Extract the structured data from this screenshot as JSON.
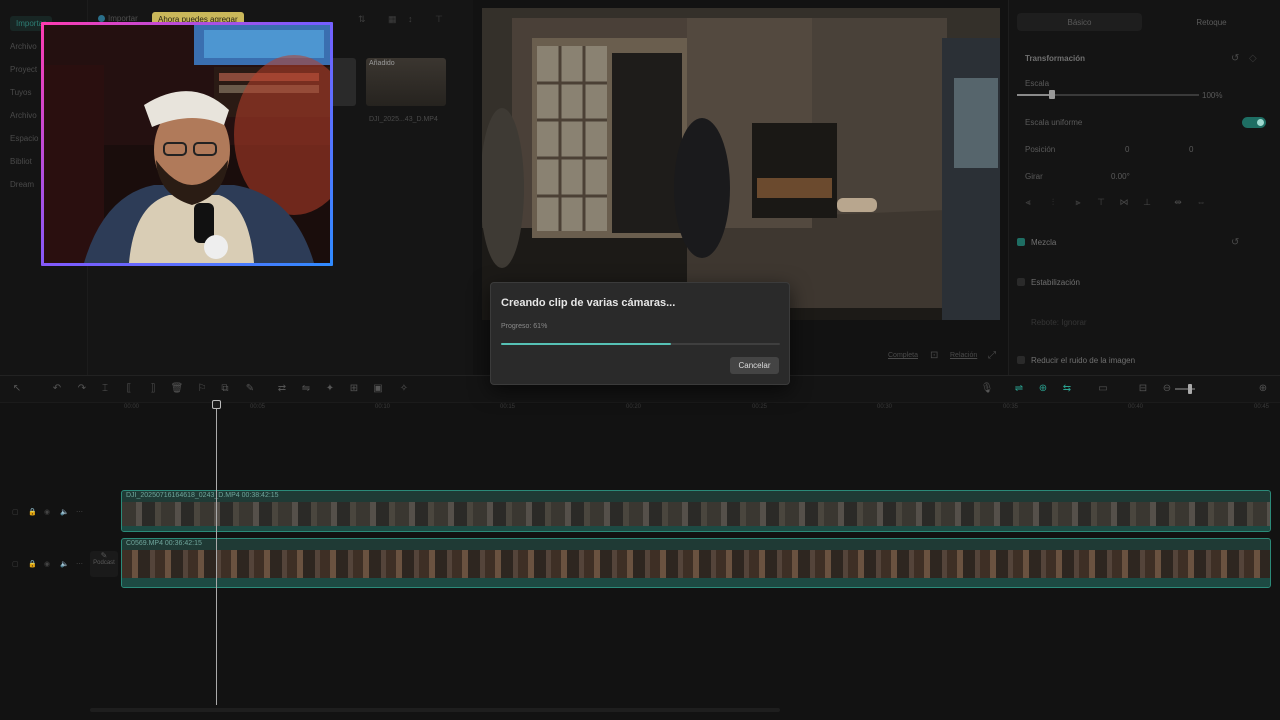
{
  "sidebar": {
    "items": [
      {
        "label": "Importar",
        "active": true
      },
      {
        "label": "Archivo"
      },
      {
        "label": "Proyect"
      },
      {
        "label": "Tuyos"
      },
      {
        "label": "Archivo"
      },
      {
        "label": "Espacio"
      },
      {
        "label": "Bibliot"
      },
      {
        "label": "Dream"
      }
    ]
  },
  "media": {
    "import_label": "Importar",
    "tooltip": "Ahora puedes agregar",
    "added_badge": "Añadido",
    "file_name": "DJI_2025...43_D.MP4"
  },
  "preview": {
    "full_label": "Completa",
    "ratio_label": "Relación"
  },
  "right_panel": {
    "tabs": [
      "Básico",
      "Retoque"
    ],
    "transform_label": "Transformación",
    "scale_label": "Escala",
    "scale_value": "100%",
    "uniform_label": "Escala uniforme",
    "position_label": "Posición",
    "pos_x": "0",
    "pos_y": "0",
    "rotate_label": "Girar",
    "rotate_value": "0.00°",
    "blend_label": "Mezcla",
    "stabilize_label": "Estabilización",
    "stabilize_sub": "Rebote: Ignorar",
    "denoise_label": "Reducir el ruido de la imagen"
  },
  "timeline": {
    "ticks": [
      "00:00",
      "00:05",
      "00:10",
      "00:15",
      "00:20",
      "00:25",
      "00:30",
      "00:35",
      "00:40",
      "00:45"
    ],
    "track1_label": "DJI_20250716164618_0243_D.MP4   00:38:42:15",
    "track2_label": "C0569.MP4   00:36:42:15",
    "podcast_label": "Podcast"
  },
  "dialog": {
    "title": "Creando clip de varias cámaras...",
    "progress_label": "Progreso: 61%",
    "progress": 0.61,
    "cancel_label": "Cancelar"
  },
  "colors": {
    "accent": "#2aa18f",
    "progress": "#56c1b5"
  }
}
